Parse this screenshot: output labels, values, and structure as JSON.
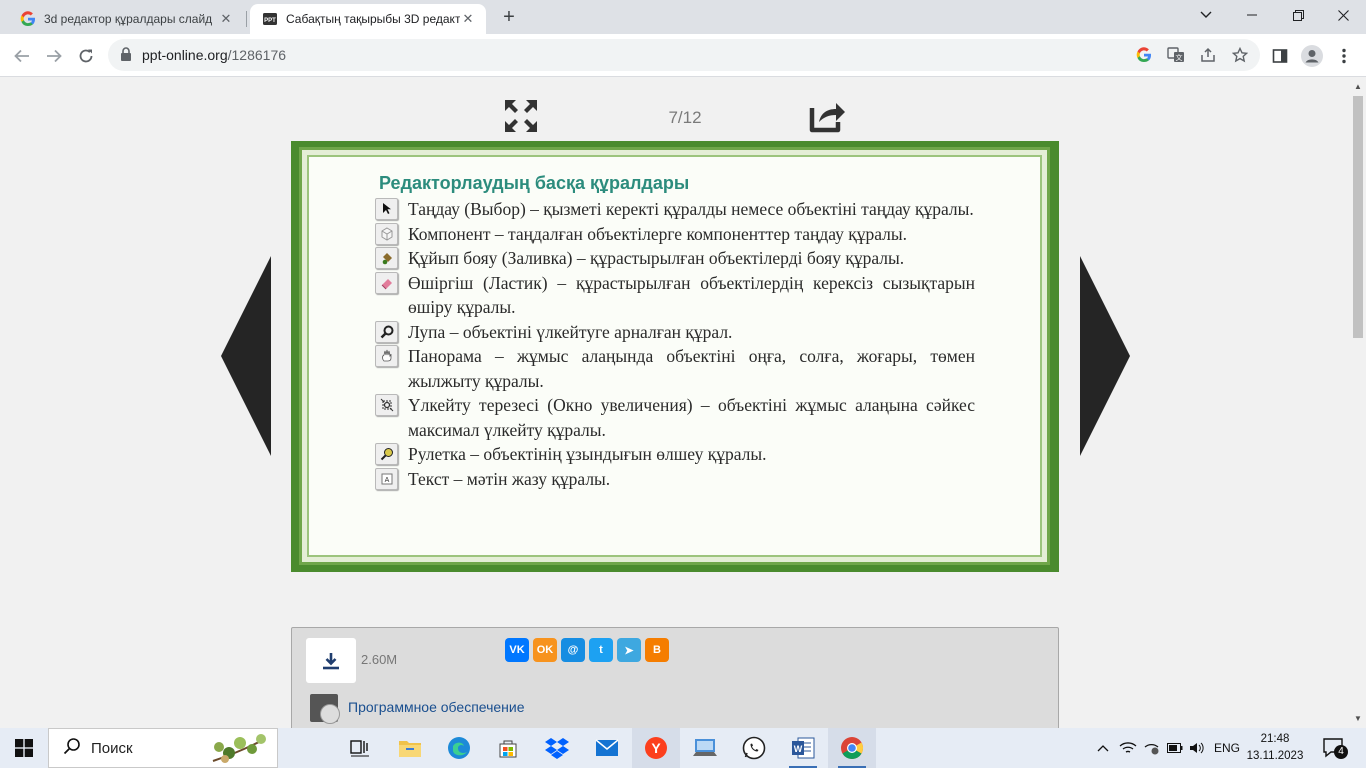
{
  "browser": {
    "tabs": [
      {
        "title": "3d редактор құралдары слайд",
        "favicon": "google-icon",
        "active": false
      },
      {
        "title": "Сабақтың тақырыбы 3D редакт",
        "favicon": "ppt-icon",
        "active": true
      }
    ],
    "url": {
      "host": "ppt-online.org",
      "path": "/1286176"
    }
  },
  "viewer": {
    "counter": "7/12",
    "slide": {
      "title": "Редакторлаудың басқа құралдары",
      "items": [
        {
          "icon": "cursor-icon",
          "text": "Таңдау (Выбор) – қызметі керекті құралды немесе объектіні таңдау құралы."
        },
        {
          "icon": "component-icon",
          "text": "Компонент – таңдалған объектілерге компоненттер таңдау құралы."
        },
        {
          "icon": "paint-bucket-icon",
          "text": "Құйып бояу (Заливка) – құрастырылған объектілерді бояу құралы."
        },
        {
          "icon": "eraser-icon",
          "text": "Өшіргіш (Ластик) – құрастырылған объектілердің керексіз сызықтарын өшіру құралы."
        },
        {
          "icon": "magnifier-icon",
          "text": "Лупа – объектіні үлкейтуге арналған құрал."
        },
        {
          "icon": "pan-hand-icon",
          "text": "Панорама – жұмыс алаңында объектіні оңға, солға, жоғары, төмен жылжыту құралы."
        },
        {
          "icon": "zoom-window-icon",
          "text": "Үлкейту терезесі (Окно увеличения) – объектіні жұмыс алаңына сәйкес максимал үлкейту құралы."
        },
        {
          "icon": "tape-measure-icon",
          "text": "Рулетка – объектінің ұзындығын өлшеу құралы."
        },
        {
          "icon": "text-tool-icon",
          "text": "Текст – мәтін жазу құралы."
        }
      ]
    }
  },
  "info": {
    "filesize": "2.60M",
    "socials": [
      {
        "name": "vk",
        "label": "VK",
        "color": "#0077ff"
      },
      {
        "name": "odnoklassniki",
        "label": "OK",
        "color": "#f7931e"
      },
      {
        "name": "moimir",
        "label": "@",
        "color": "#168de2"
      },
      {
        "name": "twitter",
        "label": "t",
        "color": "#1da1f2"
      },
      {
        "name": "telegram",
        "label": "➤",
        "color": "#3ea8e0"
      },
      {
        "name": "blogger",
        "label": "B",
        "color": "#f57d00"
      }
    ],
    "category": "Программное обеспечение"
  },
  "taskbar": {
    "search_placeholder": "Поиск",
    "language": "ENG",
    "time": "21:48",
    "date": "13.11.2023",
    "notifications": "4"
  }
}
